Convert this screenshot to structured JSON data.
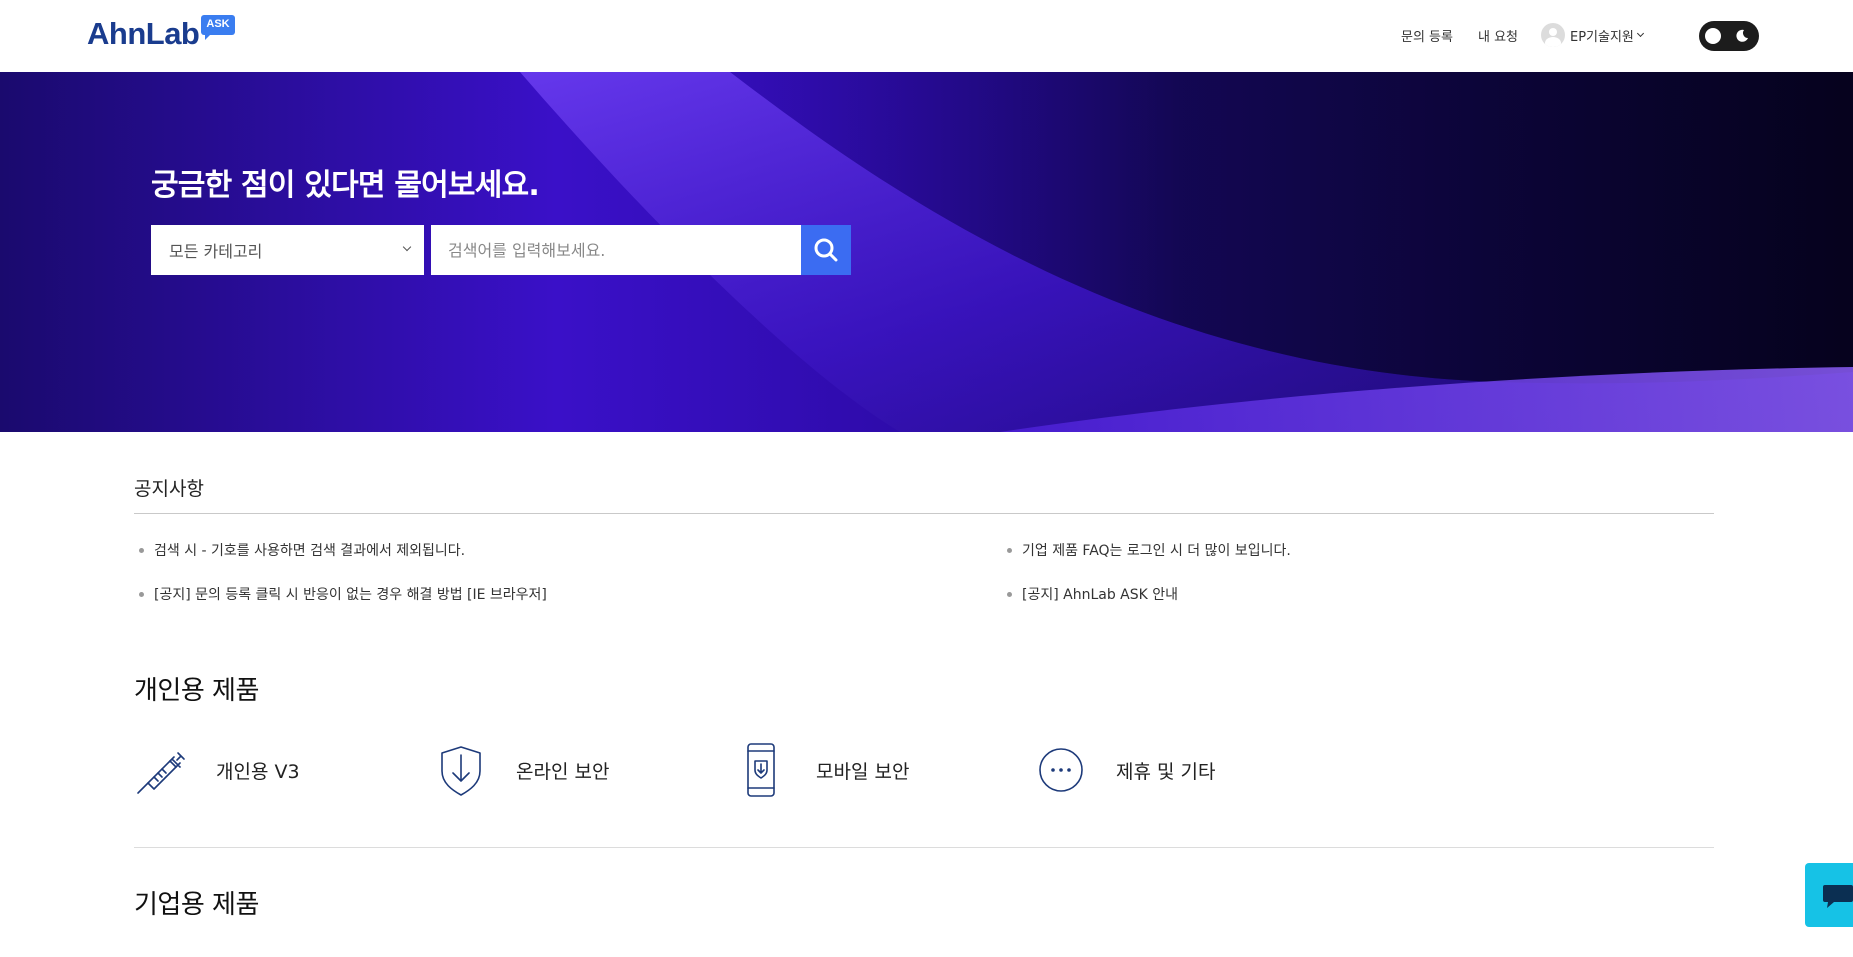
{
  "header": {
    "logo_text": "AhnLab",
    "logo_badge": "ASK",
    "nav": {
      "register_label": "문의 등록",
      "my_requests_label": "내 요청",
      "user_name": "EP기술지원"
    }
  },
  "hero": {
    "title": "궁금한 점이 있다면 물어보세요.",
    "category_selected": "모든 카테고리",
    "search_placeholder": "검색어를 입력해보세요."
  },
  "notices": {
    "title": "공지사항",
    "items": [
      "검색 시 - 기호를 사용하면 검색 결과에서 제외됩니다.",
      "기업 제품 FAQ는 로그인 시 더 많이 보입니다.",
      "[공지] 문의 등록 클릭 시 반응이 없는 경우 해결 방법 [IE 브라우저]",
      "[공지] AhnLab ASK 안내"
    ]
  },
  "personal_products": {
    "title": "개인용 제품",
    "items": [
      {
        "label": "개인용 V3",
        "icon": "syringe-icon"
      },
      {
        "label": "온라인 보안",
        "icon": "shield-download-icon"
      },
      {
        "label": "모바일 보안",
        "icon": "mobile-download-icon"
      },
      {
        "label": "제휴 및 기타",
        "icon": "more-circle-icon"
      }
    ]
  },
  "enterprise_products": {
    "title": "기업용 제품"
  },
  "colors": {
    "brand_blue": "#1a3c8e",
    "search_button": "#3b6cf2",
    "chat_button": "#16c2e6",
    "hero_purple": "#3a10c8"
  }
}
